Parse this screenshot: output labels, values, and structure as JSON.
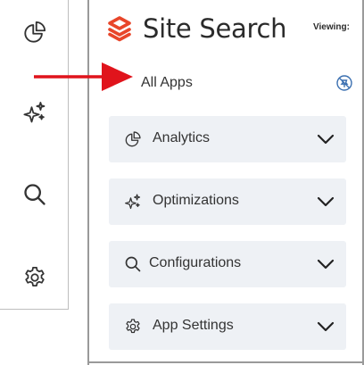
{
  "rail": {
    "items": [
      {
        "name": "analytics",
        "icon": "pie-chart-icon"
      },
      {
        "name": "optimizations",
        "icon": "sparkles-icon"
      },
      {
        "name": "search",
        "icon": "search-icon"
      },
      {
        "name": "settings",
        "icon": "gear-icon"
      }
    ]
  },
  "panel": {
    "title": "Site Search",
    "viewing_label": "Viewing:",
    "app_scope": "All Apps",
    "nav_items": [
      {
        "label": "Analytics",
        "icon": "pie-chart-icon"
      },
      {
        "label": "Optimizations",
        "icon": "sparkles-icon"
      },
      {
        "label": "Configurations",
        "icon": "search-icon"
      },
      {
        "label": "App Settings",
        "icon": "gear-icon"
      }
    ]
  },
  "colors": {
    "brand": "#e8462a",
    "annotation_arrow": "#e0141c",
    "nav_bg": "#eef1f5",
    "text": "#333333",
    "icon": "#333333"
  }
}
